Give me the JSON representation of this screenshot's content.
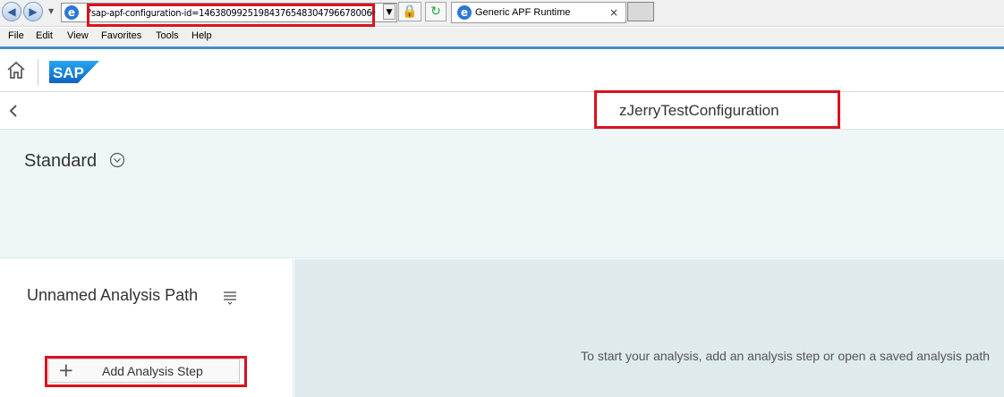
{
  "browser": {
    "url": "?sap-apf-configuration-id=14638099251984376548304796678006",
    "tab_title": "Generic APF Runtime"
  },
  "menu": [
    "File",
    "Edit",
    "View",
    "Favorites",
    "Tools",
    "Help"
  ],
  "shell": {
    "logo_text": "SAP"
  },
  "page": {
    "title": "zJerryTestConfiguration"
  },
  "filter": {
    "variant": "Standard"
  },
  "analysis": {
    "path_title": "Unnamed Analysis Path",
    "add_step_label": "Add Analysis Step",
    "empty_message": "To start your analysis, add an analysis step or open a saved analysis path"
  }
}
